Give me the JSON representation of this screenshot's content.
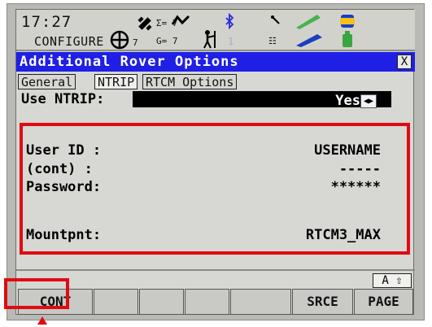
{
  "status": {
    "time": "17:27",
    "mode": "CONFIGURE",
    "satellites_top": "Σ= 7",
    "satellites_bottom": "G= 7",
    "sat_left": "7",
    "antenna_count": "1"
  },
  "dialog": {
    "title": "Additional Rover Options",
    "close": "X"
  },
  "tabs": [
    "General",
    "NTRIP",
    "RTCM Options"
  ],
  "use_ntrip": {
    "label": "Use NTRIP:",
    "value": "Yes"
  },
  "fields": [
    {
      "label": "User ID :",
      "value": "USERNAME"
    },
    {
      "label": "(cont)  :",
      "value": "-----"
    },
    {
      "label": "Password:",
      "value": "******"
    },
    {
      "label": "Mountpnt:",
      "value": "RTCM3_MAX"
    }
  ],
  "input_mode": "A ⇧",
  "function_keys": [
    "CONT",
    "",
    "",
    "",
    "",
    "SRCE",
    "PAGE"
  ],
  "colors": {
    "titlebar": "#1f1fe6",
    "highlight": "#e10a12"
  },
  "icons": [
    "crosshair-icon",
    "satellite-icon",
    "signal-icon",
    "bluetooth-icon",
    "rover-icon",
    "radio-icon",
    "pen-icon",
    "battery-icon"
  ]
}
